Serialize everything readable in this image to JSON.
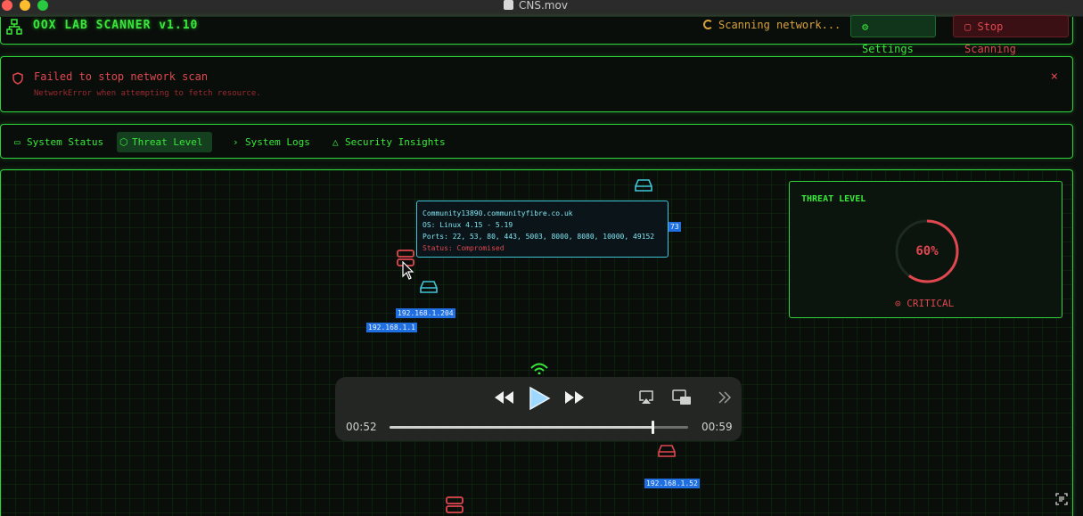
{
  "window": {
    "title": "CNS.mov"
  },
  "header": {
    "app_title": "OOX LAB SCANNER v1.10",
    "scan_status": "Scanning network...",
    "settings_label": "Settings",
    "stop_label": "Stop Scanning"
  },
  "alert": {
    "title": "Failed to stop network scan",
    "message": "NetworkError when attempting to fetch resource.",
    "close": "×"
  },
  "tabs": [
    {
      "label": "System Status",
      "icon": "monitor-icon",
      "active": false
    },
    {
      "label": "Threat Level",
      "icon": "shield-icon",
      "active": true
    },
    {
      "label": "System Logs",
      "icon": "terminal-icon",
      "active": false
    },
    {
      "label": "Security Insights",
      "icon": "warning-icon",
      "active": false
    }
  ],
  "map": {
    "tooltip": {
      "host": "Community13890.communityfibre.co.uk",
      "os": "OS: Linux 4.15 - 5.19",
      "ports": "Ports: 22, 53, 80, 443, 5003, 8000, 8080, 10000, 49152",
      "status": "Status: Compromised"
    },
    "ip_labels": [
      "192.168.1.204",
      "192.168.1.1",
      "192.168.1.52",
      "73"
    ]
  },
  "threat": {
    "label": "THREAT LEVEL",
    "percent_text": "60%",
    "level": 0.6,
    "severity": "CRITICAL",
    "color": "#e0474f"
  },
  "player": {
    "current": "00:52",
    "duration": "00:59",
    "progress": 0.88
  },
  "colors": {
    "accent": "#39e83a",
    "danger": "#e0474f",
    "info": "#3fc6d6",
    "warning": "#d9a23a"
  }
}
